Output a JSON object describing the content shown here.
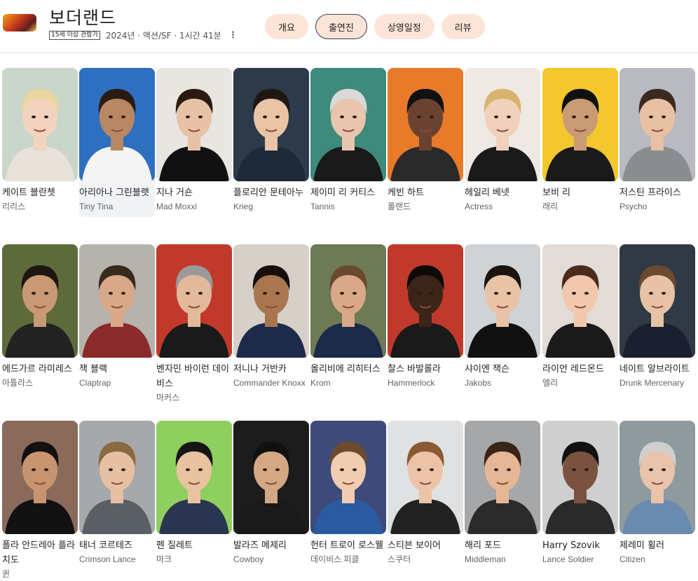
{
  "movie": {
    "title": "보더랜드",
    "rating_badge": "15세 이상 관람가",
    "info": "2024년 · 액션/SF · 1시간 41분",
    "more_icon": "more-vert-icon"
  },
  "tabs": [
    {
      "label": "개요",
      "active": false
    },
    {
      "label": "출연진",
      "active": true
    },
    {
      "label": "상영일정",
      "active": false
    },
    {
      "label": "리뷰",
      "active": false
    }
  ],
  "cast": [
    {
      "name": "케이트 블란쳇",
      "role": "리리스"
    },
    {
      "name": "아리아나 그린블랫",
      "role": "Tiny Tina"
    },
    {
      "name": "지나 거숀",
      "role": "Mad Moxxi"
    },
    {
      "name": "플로리안 문테아누",
      "role": "Krieg"
    },
    {
      "name": "제이미 리 커티스",
      "role": "Tannis"
    },
    {
      "name": "케빈 하트",
      "role": "롤랜드"
    },
    {
      "name": "헤일리 베넷",
      "role": "Actress"
    },
    {
      "name": "보비 리",
      "role": "래리"
    },
    {
      "name": "저스틴 프라이스",
      "role": "Psycho"
    },
    {
      "name": "에드가르 라미레스",
      "role": "아틀라스"
    },
    {
      "name": "잭 블랙",
      "role": "Claptrap"
    },
    {
      "name": "벤자민 바이런 데이비스",
      "role": "마커스"
    },
    {
      "name": "저니나 거반카",
      "role": "Commander Knoxx"
    },
    {
      "name": "올리비에 리히터스",
      "role": "Krom"
    },
    {
      "name": "찰스 바발롤라",
      "role": "Hammerlock"
    },
    {
      "name": "샤이엔 잭슨",
      "role": "Jakobs"
    },
    {
      "name": "라이언 레드몬드",
      "role": "엘리"
    },
    {
      "name": "네이트 알브라이트",
      "role": "Drunk Mercenary"
    },
    {
      "name": "폴라 안드레아 플라치도",
      "role": "퀸"
    },
    {
      "name": "태너 코르테즈",
      "role": "Crimson Lance"
    },
    {
      "name": "펜 질레트",
      "role": "마크"
    },
    {
      "name": "발라즈 메제리",
      "role": "Cowboy"
    },
    {
      "name": "헌터 트로이 로스웰",
      "role": "데이비스 피클"
    },
    {
      "name": "스티븐 보이어",
      "role": "스쿠터"
    },
    {
      "name": "해리 포드",
      "role": "Middleman"
    },
    {
      "name": "Harry Szovik",
      "role": "Lance Soldier"
    },
    {
      "name": "제레미 휠러",
      "role": "Citizen"
    }
  ],
  "colors": {
    "tab_bg": "#fde4d8",
    "highlight_bg": "#f1f3f4",
    "photo_bgs": [
      "#c9d6c9",
      "#2f6fc0",
      "#e9e6e2",
      "#2c3a4a",
      "#3e8a7c",
      "#e87a2a",
      "#efe9e4",
      "#f4c72e",
      "#b8b9c1",
      "#5d6a3a",
      "#b6b3ad",
      "#c0392b",
      "#d7d0c8",
      "#6d7a55",
      "#c0392b",
      "#cfd3d6",
      "#e1dcd6",
      "#2f3a44",
      "#8a6a5a",
      "#a6a9ac",
      "#8fcf5f",
      "#1c1c1c",
      "#3d4a7a",
      "#dfe1e3",
      "#a5a7a9",
      "#cfcfcf",
      "#8e9a9e"
    ],
    "skin_tones": [
      "#f2d3bd",
      "#b98764",
      "#e7c2a6",
      "#e9c4a6",
      "#e8c6ad",
      "#6a4330",
      "#f0d2bc",
      "#c99c76",
      "#e8c0a3",
      "#c99874",
      "#d9a888",
      "#e3b99b",
      "#a9764f",
      "#d8a888",
      "#3b2418",
      "#e9c3a5",
      "#f1c7ae",
      "#e8c2a7",
      "#c8946f",
      "#e6c0a2",
      "#e9c2a0",
      "#d4a884",
      "#f0cdb1",
      "#edc3a7",
      "#e6b797",
      "#7a5240",
      "#e8c4ad"
    ],
    "hair_colors": [
      "#e8d7a0",
      "#2a1b12",
      "#2a1a12",
      "#1f1712",
      "#d9d9d9",
      "#111111",
      "#d9b26e",
      "#111111",
      "#3a2a20",
      "#1d1510",
      "#3a2a1e",
      "#9a9a9a",
      "#150f0c",
      "#6a4a2e",
      "#0d0a08",
      "#1c1410",
      "#4a2b1c",
      "#6a4a30",
      "#151010",
      "#8a6a3e",
      "#151515",
      "#111111",
      "#6b4a2e",
      "#8a5a32",
      "#3a2418",
      "#111111",
      "#cfcfcf"
    ],
    "shirt_colors": [
      "#e8e2d8",
      "#f4f4f4",
      "#111111",
      "#1e2a3a",
      "#1a1a1a",
      "#2a2a2a",
      "#1a1a1a",
      "#1a1a1a",
      "#8a8d8e",
      "#222222",
      "#8a2a2a",
      "#1a1a1a",
      "#1e2a4a",
      "#1c2a4a",
      "#1a1a1a",
      "#111111",
      "#1a1a1a",
      "#1a2030",
      "#111111",
      "#5a5f66",
      "#2a3550",
      "#1a1a1a",
      "#2a5aa0",
      "#222222",
      "#2b2b2b",
      "#2a2a2a",
      "#6a8ab0"
    ]
  }
}
